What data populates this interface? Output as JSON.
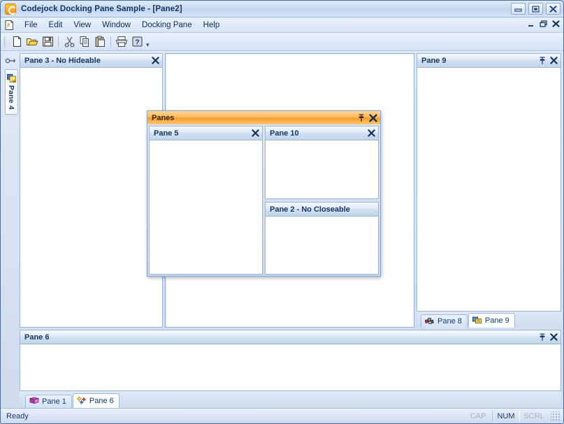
{
  "window": {
    "title": "Codejock Docking Pane Sample - [Pane2]",
    "app_icon": "codejock-logo-icon",
    "buttons": {
      "minimize": "minimize-icon",
      "maximize": "maximize-icon",
      "close": "close-icon"
    }
  },
  "menubar": {
    "doc_icon": "mdi-document-icon",
    "items": [
      {
        "label": "File"
      },
      {
        "label": "Edit"
      },
      {
        "label": "View"
      },
      {
        "label": "Window"
      },
      {
        "label": "Docking Pane"
      },
      {
        "label": "Help"
      }
    ],
    "mdi_buttons": {
      "minimize": "mdi-minimize-icon",
      "restore": "mdi-restore-icon",
      "close": "mdi-close-icon"
    }
  },
  "toolbar": {
    "buttons": [
      {
        "name": "new-icon",
        "title": "New"
      },
      {
        "name": "open-icon",
        "title": "Open"
      },
      {
        "name": "save-icon",
        "title": "Save"
      },
      {
        "name": "cut-icon",
        "title": "Cut"
      },
      {
        "name": "copy-icon",
        "title": "Copy"
      },
      {
        "name": "paste-icon",
        "title": "Paste"
      },
      {
        "name": "print-icon",
        "title": "Print"
      },
      {
        "name": "help-icon",
        "title": "About"
      }
    ],
    "overflow": "▾"
  },
  "autohide": {
    "pin_icon": "auto-hide-pin-icon",
    "tabs": [
      {
        "label": "Pane 4",
        "icon": "help-window-icon"
      }
    ]
  },
  "panes": {
    "pane3": {
      "title": "Pane 3 - No Hideable",
      "has_pin": false,
      "has_close": true
    },
    "pane9": {
      "title": "Pane 9",
      "has_pin": true,
      "has_close": true
    },
    "pane6": {
      "title": "Pane 6",
      "has_pin": true,
      "has_close": true
    },
    "pane5": {
      "title": "Pane 5",
      "has_pin": false,
      "has_close": true
    },
    "pane10": {
      "title": "Pane 10",
      "has_pin": false,
      "has_close": true
    },
    "pane2": {
      "title": "Pane 2 - No Closeable",
      "has_pin": false,
      "has_close": false
    }
  },
  "floating": {
    "title": "Panes",
    "has_pin": true,
    "has_close": true,
    "accent_color": "#f59c24"
  },
  "right_tabs": [
    {
      "label": "Pane 8",
      "icon": "blocks-icon",
      "active": false
    },
    {
      "label": "Pane 9",
      "icon": "window-icon",
      "active": true
    }
  ],
  "bottom_tabs": [
    {
      "label": "Pane 1",
      "icon": "book-icon",
      "active": false
    },
    {
      "label": "Pane 6",
      "icon": "sparkle-icon",
      "active": true
    }
  ],
  "statusbar": {
    "message": "Ready",
    "indicators": [
      {
        "label": "CAP",
        "active": false
      },
      {
        "label": "NUM",
        "active": true
      },
      {
        "label": "SCRL",
        "active": false
      }
    ]
  },
  "glyphs": {
    "close": "✕",
    "pin": "⚐"
  }
}
